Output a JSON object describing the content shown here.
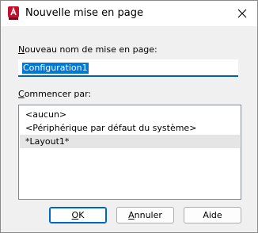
{
  "window": {
    "title": "Nouvelle mise en page",
    "app_icon": "autocad-a-icon",
    "close_icon": "close-icon"
  },
  "name_field": {
    "label_accel": "N",
    "label_rest": "ouveau nom de mise en page:",
    "value": "Configuration1"
  },
  "start_with": {
    "label_accel": "C",
    "label_rest": "ommencer par:",
    "items": [
      {
        "label": "<aucun>",
        "selected": false
      },
      {
        "label": "<Périphérique par défaut du système>",
        "selected": false
      },
      {
        "label": "*Layout1*",
        "selected": true
      }
    ]
  },
  "buttons": {
    "ok_accel": "O",
    "ok_rest": "K",
    "cancel_accel": "A",
    "cancel_rest": "nnuler",
    "help_label": "Aide"
  },
  "colors": {
    "accent": "#0078d7",
    "icon_red": "#c8102e"
  }
}
